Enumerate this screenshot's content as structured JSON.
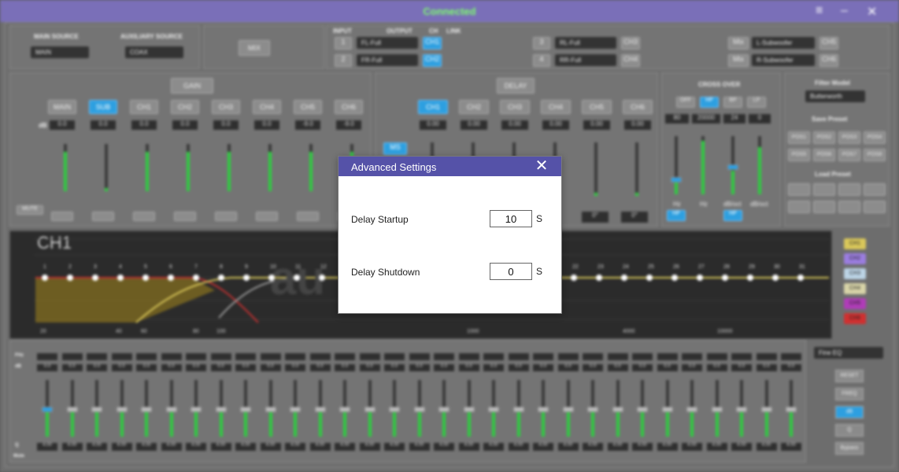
{
  "window": {
    "status": "Connected"
  },
  "source": {
    "main_label": "MAIN SOURCE",
    "main_value": "MAIN",
    "aux_label": "AUXILIARY SOURCE",
    "aux_value": "COAX",
    "mix": "MIX"
  },
  "routing": {
    "hdr_input": "INPUT",
    "hdr_output": "OUTPUT",
    "hdr_ch": "CH",
    "hdr_link": "LINK",
    "rows": [
      {
        "in": "1",
        "out": "FL-Full",
        "ch": "CH1"
      },
      {
        "in": "2",
        "out": "FR-Full",
        "ch": "CH2"
      },
      {
        "in": "3",
        "out": "RL-Full",
        "ch": "CH3"
      },
      {
        "in": "4",
        "out": "RR-Full",
        "ch": "CH4"
      },
      {
        "in": "Mix",
        "out": "L-Subwoofer",
        "ch": "CH5"
      },
      {
        "in": "Mix",
        "out": "R-Subwoofer",
        "ch": "CH6"
      }
    ]
  },
  "gain": {
    "title": "GAIN",
    "buttons": [
      "MAIN",
      "SUB",
      "CH1",
      "CH2",
      "CH3",
      "CH4",
      "CH5",
      "CH6"
    ],
    "db": "dB",
    "values": [
      "0.0",
      "0.0",
      "0.0",
      "0.0",
      "0.0",
      "0.0",
      "-9.0",
      "-9.0"
    ],
    "mute": "MUTE"
  },
  "delay": {
    "title": "DELAY",
    "buttons": [
      "CH1",
      "CH2",
      "CH3",
      "CH4",
      "CH5",
      "CH6"
    ],
    "values": [
      "0.00",
      "0.00",
      "0.00",
      "0.00",
      "0.00",
      "0.00"
    ],
    "ms": "MS",
    "phase": [
      "0°",
      "0°"
    ]
  },
  "crossover": {
    "title": "CROSS OVER",
    "modes": [
      "OFF",
      "HP",
      "BP",
      "LP"
    ],
    "values": [
      "80",
      "20000",
      "24",
      "0"
    ],
    "labels": [
      "Hz",
      "Hz",
      "dB/oct",
      "dB/oct"
    ],
    "btns": [
      "HP",
      "LP"
    ]
  },
  "filter": {
    "label": "Filter Model",
    "value": "Butterworth"
  },
  "presets": {
    "save": "Save Preset",
    "slots": [
      "POS1",
      "POS2",
      "POS3",
      "POS4",
      "POS5",
      "POS6",
      "POS7",
      "POS8"
    ],
    "load": "Load Preset"
  },
  "eq_graph": {
    "channel": "CH1",
    "points": [
      "1",
      "2",
      "3",
      "4",
      "5",
      "6",
      "7",
      "8",
      "9",
      "10",
      "11",
      "12",
      "22",
      "23",
      "24",
      "25",
      "26",
      "27",
      "28",
      "29",
      "30",
      "31"
    ],
    "freq_ticks": [
      "20",
      "40",
      "60",
      "80",
      "100",
      "1000",
      "4000",
      "10000"
    ],
    "legend": [
      "CH1",
      "CH2",
      "CH3",
      "CH4",
      "CH5",
      "CH6"
    ]
  },
  "eq_side": {
    "mode": "Fine EQ",
    "buttons": [
      "RESET",
      "FREQ",
      "dB",
      "Q",
      "Bypass"
    ]
  },
  "eq_bands": {
    "freq_label": "FHz",
    "db_label": "dB",
    "q_label": "Q",
    "mute_label": "Mute",
    "q_value": "4.00",
    "db_value": "0.0"
  },
  "modal": {
    "title": "Advanced Settings",
    "close": "✕",
    "startup_label": "Delay Startup",
    "startup_value": "10",
    "startup_unit": "S",
    "shutdown_label": "Delay Shutdown",
    "shutdown_value": "0",
    "shutdown_unit": "S"
  },
  "colors": {
    "header": "#5552a8",
    "accent_blue": "#2d9fe0",
    "status_green": "#7dff6b"
  }
}
